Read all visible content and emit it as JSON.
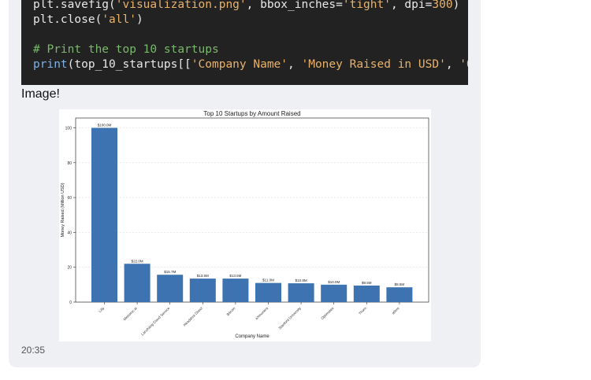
{
  "code": {
    "lines": [
      [
        {
          "t": "plt.savefig(",
          "c": "plain"
        },
        {
          "t": "'visualization.png'",
          "c": "str"
        },
        {
          "t": ", bbox_inches=",
          "c": "plain"
        },
        {
          "t": "'tight'",
          "c": "str"
        },
        {
          "t": ", dpi=",
          "c": "plain"
        },
        {
          "t": "300",
          "c": "num"
        },
        {
          "t": ")",
          "c": "plain"
        }
      ],
      [
        {
          "t": "plt.close(",
          "c": "plain"
        },
        {
          "t": "'all'",
          "c": "str"
        },
        {
          "t": ")",
          "c": "plain"
        }
      ],
      [],
      [
        {
          "t": "# Print the top 10 startups",
          "c": "com"
        }
      ],
      [
        {
          "t": "print",
          "c": "fn"
        },
        {
          "t": "(top_10_startups[[",
          "c": "plain"
        },
        {
          "t": "'Company Name'",
          "c": "str"
        },
        {
          "t": ", ",
          "c": "plain"
        },
        {
          "t": "'Money Raised in USD'",
          "c": "str"
        },
        {
          "t": ", ",
          "c": "plain"
        },
        {
          "t": "'Organizat",
          "c": "str"
        }
      ]
    ]
  },
  "message": {
    "label": "Image!",
    "time": "20:35"
  },
  "chart_data": {
    "type": "bar",
    "title": "Top 10 Startups by Amount Raised",
    "xlabel": "Company Name",
    "ylabel": "Money Raised (Million USD)",
    "ylim": [
      0,
      100
    ],
    "yticks": [
      0,
      20,
      40,
      60,
      80,
      100
    ],
    "grid": true,
    "color": "#3d73b0",
    "categories": [
      "Lilly",
      "Metronic.ai",
      "Lanzhang Cloud Service",
      "Headshot Direct",
      "Bitcoin",
      "eXmunera",
      "Stanford University",
      "Optimates",
      "Thorn",
      "atlers"
    ],
    "values": [
      100.0,
      22.0,
      15.7,
      13.5,
      13.5,
      11.0,
      10.8,
      10.0,
      9.5,
      8.5
    ],
    "data_labels": [
      "$100.0M",
      "$22.0M",
      "$15.7M",
      "$13.5M",
      "$13.5M",
      "$11.0M",
      "$10.8M",
      "$10.0M",
      "$9.5M",
      "$8.5M"
    ]
  }
}
